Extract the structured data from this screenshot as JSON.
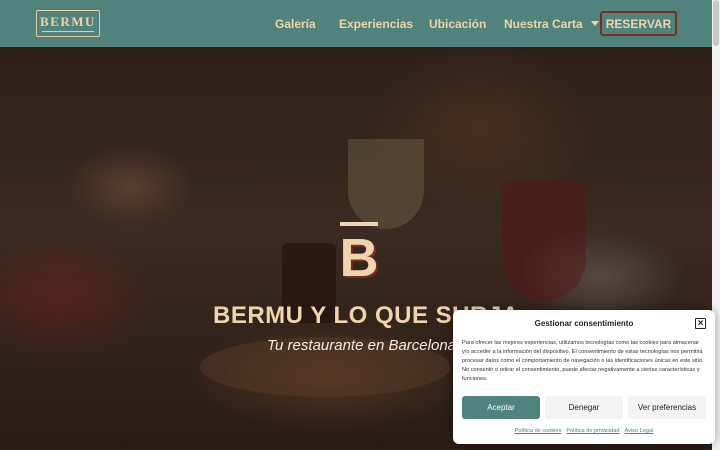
{
  "header": {
    "logo_text": "BERMU",
    "nav": {
      "galeria": "Galería",
      "experiencias": "Experiencias",
      "ubicacion": "Ubicación",
      "nuestra_carta": "Nuestra Carta"
    },
    "reservar": "RESERVAR"
  },
  "hero": {
    "emblem_letter": "B",
    "title": "BERMU Y LO QUE SURJA",
    "subtitle": "Tu restaurante en Barcelona"
  },
  "consent": {
    "title": "Gestionar consentimiento",
    "body": "Para ofrecer las mejores experiencias, utilizamos tecnologías como las cookies para almacenar y/o acceder a la información del dispositivo. El consentimiento de estas tecnologías nos permitirá procesar datos como el comportamiento de navegación o las identificaciones únicas en este sitio. No consentir o retirar el consentimiento, puede afectar negativamente a ciertas características y funciones.",
    "accept": "Aceptar",
    "deny": "Denegar",
    "preferences": "Ver preferencias",
    "links": {
      "cookies": "Política de cookies",
      "privacy": "Política de privacidad",
      "legal": "Aviso Legal"
    },
    "close_icon": "×"
  },
  "colors": {
    "header_bg": "#4f837b",
    "accent_text": "#f0d4ae",
    "reservar_border": "#7a2b22",
    "accept_bg": "#4f837b"
  }
}
